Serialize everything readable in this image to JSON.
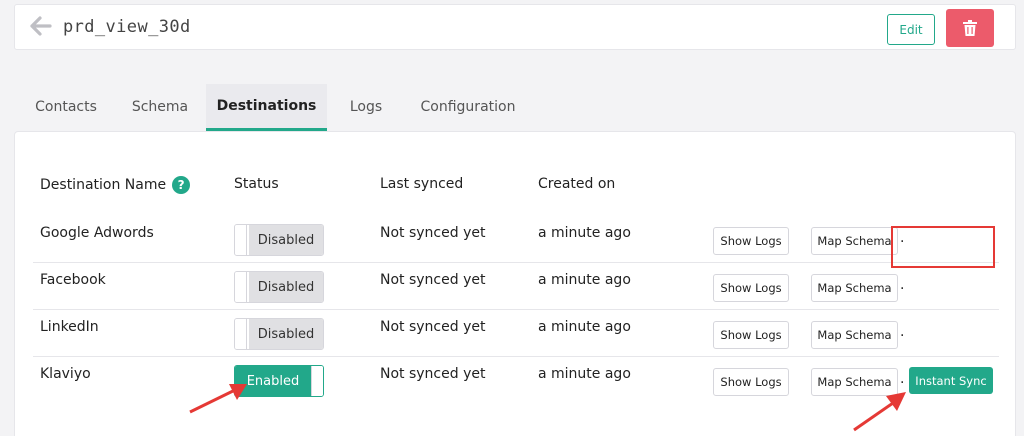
{
  "header": {
    "title": "prd_view_30d",
    "edit_label": "Edit",
    "back_icon": "arrow-left-icon",
    "delete_icon": "trash-icon"
  },
  "tabs": [
    {
      "label": "Contacts",
      "active": false
    },
    {
      "label": "Schema",
      "active": false
    },
    {
      "label": "Destinations",
      "active": true
    },
    {
      "label": "Logs",
      "active": false
    },
    {
      "label": "Configuration",
      "active": false
    }
  ],
  "table": {
    "headers": {
      "name": "Destination Name",
      "status": "Status",
      "last_synced": "Last synced",
      "created_on": "Created on",
      "help_icon": "?"
    },
    "rows": [
      {
        "name": "Google Adwords",
        "status": "Disabled",
        "enabled": false,
        "last_synced": "Not synced yet",
        "created_on": "a minute ago",
        "show_logs": "Show Logs",
        "map_schema": "Map Schema",
        "dot": "."
      },
      {
        "name": "Facebook",
        "status": "Disabled",
        "enabled": false,
        "last_synced": "Not synced yet",
        "created_on": "a minute ago",
        "show_logs": "Show Logs",
        "map_schema": "Map Schema",
        "dot": "."
      },
      {
        "name": "LinkedIn",
        "status": "Disabled",
        "enabled": false,
        "last_synced": "Not synced yet",
        "created_on": "a minute ago",
        "show_logs": "Show Logs",
        "map_schema": "Map Schema",
        "dot": "."
      },
      {
        "name": "Klaviyo",
        "status": "Enabled",
        "enabled": true,
        "last_synced": "Not synced yet",
        "created_on": "a minute ago",
        "show_logs": "Show Logs",
        "map_schema": "Map Schema",
        "dot": ".",
        "instant_sync": "Instant Sync"
      }
    ]
  },
  "colors": {
    "accent": "#22a88a",
    "danger": "#ec5b6b",
    "annotation": "#e53935"
  }
}
